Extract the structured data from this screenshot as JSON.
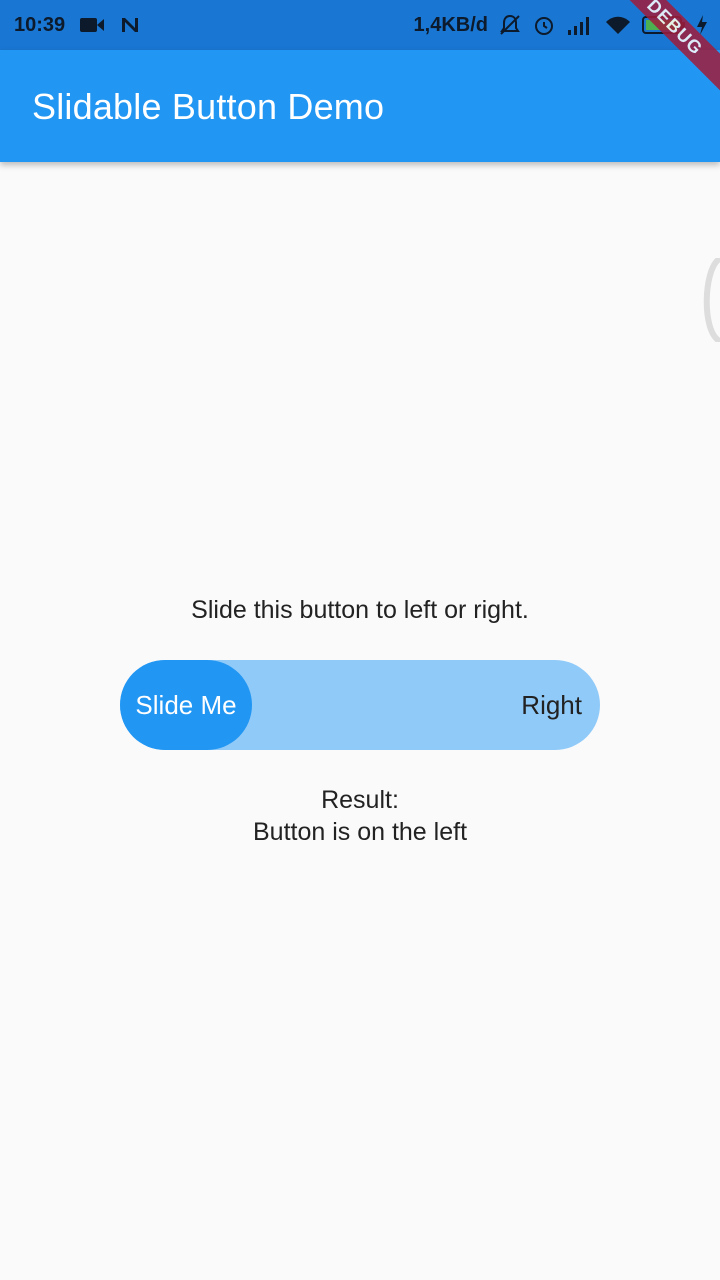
{
  "status_bar": {
    "time": "10:39",
    "network_speed": "1,4KB/d",
    "battery_level": "100",
    "colors": {
      "background": "#1976d2"
    },
    "icons": [
      "video-camera-icon",
      "notification-n-icon",
      "muted-bell-icon",
      "alarm-icon",
      "signal-icon",
      "wifi-icon",
      "battery-icon",
      "charging-icon"
    ]
  },
  "app_bar": {
    "title": "Slidable Button Demo",
    "color": "#2196f3"
  },
  "debug_banner": {
    "label": "DEBUG"
  },
  "main": {
    "instruction": "Slide this button to left or right.",
    "slider": {
      "button_label": "Slide Me",
      "right_label": "Right",
      "position": "left",
      "track_color": "#90caf9",
      "button_color": "#2196f3"
    },
    "result": {
      "heading": "Result:",
      "value": "Button is on the left"
    }
  }
}
